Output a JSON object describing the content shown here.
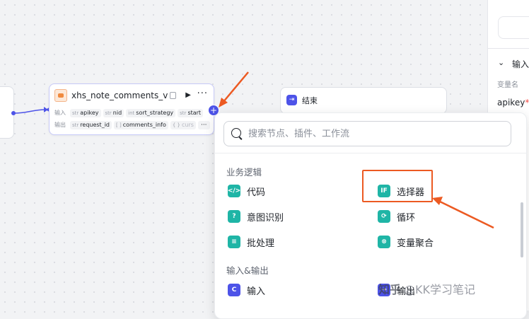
{
  "node_main": {
    "title": "xhs_note_comments_v",
    "input_label": "输入",
    "output_label": "输出",
    "inputs": [
      {
        "type": "str",
        "name": "apikey"
      },
      {
        "type": "str",
        "name": "nid"
      },
      {
        "type": "int",
        "name": "sort_strategy"
      },
      {
        "type": "str",
        "name": "start"
      }
    ],
    "outputs": [
      {
        "type": "str",
        "name": "request_id"
      },
      {
        "type": "[ ]",
        "name": "comments_info"
      },
      {
        "type": "{ }",
        "name": "curs"
      }
    ],
    "more_label": "···"
  },
  "node_end": {
    "title": "结束"
  },
  "popup": {
    "search_placeholder": "搜索节点、插件、工作流",
    "groups": [
      {
        "title": "业务逻辑",
        "items": [
          {
            "label": "代码",
            "icon": "code-icon",
            "glyph": "</>"
          },
          {
            "label": "选择器",
            "icon": "if-icon",
            "glyph": "IF"
          },
          {
            "label": "意图识别",
            "icon": "intent-icon",
            "glyph": "?"
          },
          {
            "label": "循环",
            "icon": "loop-icon",
            "glyph": "⟳"
          },
          {
            "label": "批处理",
            "icon": "batch-icon",
            "glyph": "≡"
          },
          {
            "label": "变量聚合",
            "icon": "aggregate-icon",
            "glyph": "⊗"
          }
        ]
      },
      {
        "title": "输入&输出",
        "items": [
          {
            "label": "输入",
            "icon": "input-icon",
            "glyph": "C"
          },
          {
            "label": "输出",
            "icon": "output-icon",
            "glyph": "→"
          }
        ]
      }
    ]
  },
  "right_panel": {
    "section_title": "输入",
    "var_label": "变量名",
    "var_name": "apikey",
    "required_mark": "*"
  },
  "watermark": {
    "logo": "知乎",
    "text": "@KK学习笔记"
  },
  "colors": {
    "accent": "#4d53e8",
    "teal": "#1fb5a6",
    "annotation": "#ec5a22"
  }
}
